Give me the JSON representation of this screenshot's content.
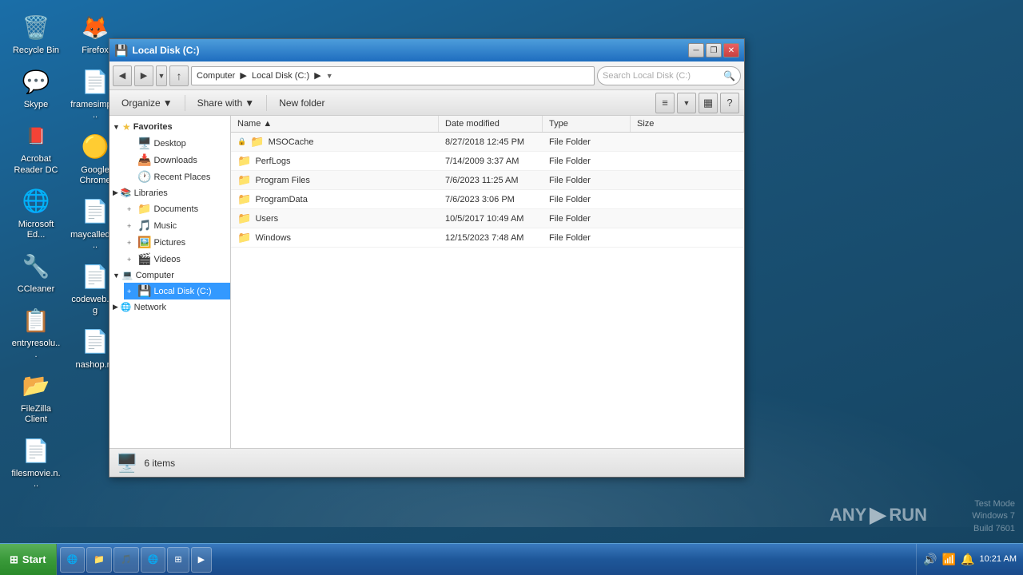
{
  "desktop": {
    "background_color": "#1a5276",
    "icons": [
      {
        "id": "recycle-bin",
        "label": "Recycle Bin",
        "icon": "🗑️"
      },
      {
        "id": "skype",
        "label": "Skype",
        "icon": "💬"
      },
      {
        "id": "acrobat",
        "label": "Acrobat Reader DC",
        "icon": "📄"
      },
      {
        "id": "microsoft-edge",
        "label": "Microsoft Ed...",
        "icon": "🌐"
      },
      {
        "id": "ccleaner",
        "label": "CCleaner",
        "icon": "🔧"
      },
      {
        "id": "entryresolution",
        "label": "entryresolu...",
        "icon": "📋"
      },
      {
        "id": "filezilla",
        "label": "FileZilla Client",
        "icon": "📂"
      },
      {
        "id": "filesmovie",
        "label": "filesmovie.n...",
        "icon": "📄"
      },
      {
        "id": "firefox",
        "label": "Firefox",
        "icon": "🦊"
      },
      {
        "id": "framesimply",
        "label": "framesimply...",
        "icon": "📄"
      },
      {
        "id": "chrome",
        "label": "Google Chrome",
        "icon": "🔵"
      },
      {
        "id": "maycalled",
        "label": "maycalled.p...",
        "icon": "📄"
      },
      {
        "id": "codeweb",
        "label": "codeweb.png",
        "icon": "📄"
      },
      {
        "id": "nashop",
        "label": "nashop.rtf",
        "icon": "📄"
      }
    ]
  },
  "taskbar": {
    "start_label": "Start",
    "time": "10:21 AM",
    "taskbar_items": [
      {
        "id": "ie",
        "label": "Internet Explorer",
        "icon": "🌐"
      },
      {
        "id": "folder",
        "label": "Folder",
        "icon": "📁"
      },
      {
        "id": "media",
        "label": "Media",
        "icon": "🎵"
      },
      {
        "id": "ie2",
        "label": "Internet Explorer",
        "icon": "🌐"
      },
      {
        "id": "windows",
        "label": "Windows",
        "icon": "⊞"
      },
      {
        "id": "arrow",
        "label": "Arrow",
        "icon": "▶"
      }
    ]
  },
  "watermark": {
    "line1": "Test Mode",
    "line2": "Windows 7",
    "line3": "Build 7601"
  },
  "anyrun": {
    "text": "ANY ▶ RUN"
  },
  "explorer": {
    "title": "Local Disk (C:)",
    "address": {
      "back_tooltip": "Back",
      "forward_tooltip": "Forward",
      "breadcrumb": "Computer  ▶  Local Disk (C:)  ▶",
      "search_placeholder": "Search Local Disk (C:)"
    },
    "toolbar": {
      "organize_label": "Organize",
      "share_with_label": "Share with",
      "new_folder_label": "New folder"
    },
    "nav_tree": {
      "favorites_label": "Favorites",
      "favorites_items": [
        {
          "id": "desktop",
          "label": "Desktop"
        },
        {
          "id": "downloads",
          "label": "Downloads"
        },
        {
          "id": "recent-places",
          "label": "Recent Places"
        }
      ],
      "libraries_label": "Libraries",
      "libraries_items": [
        {
          "id": "documents",
          "label": "Documents"
        },
        {
          "id": "music",
          "label": "Music"
        },
        {
          "id": "pictures",
          "label": "Pictures"
        },
        {
          "id": "videos",
          "label": "Videos"
        }
      ],
      "computer_label": "Computer",
      "computer_items": [
        {
          "id": "local-disk-c",
          "label": "Local Disk (C:)",
          "selected": true
        }
      ],
      "network_label": "Network"
    },
    "file_list": {
      "columns": [
        {
          "id": "name",
          "label": "Name"
        },
        {
          "id": "date_modified",
          "label": "Date modified"
        },
        {
          "id": "type",
          "label": "Type"
        },
        {
          "id": "size",
          "label": "Size"
        }
      ],
      "files": [
        {
          "name": "MSOCache",
          "date": "8/27/2018 12:45 PM",
          "type": "File Folder",
          "size": "",
          "locked": true
        },
        {
          "name": "PerfLogs",
          "date": "7/14/2009 3:37 AM",
          "type": "File Folder",
          "size": "",
          "locked": false
        },
        {
          "name": "Program Files",
          "date": "7/6/2023 11:25 AM",
          "type": "File Folder",
          "size": "",
          "locked": false
        },
        {
          "name": "ProgramData",
          "date": "7/6/2023 3:06 PM",
          "type": "File Folder",
          "size": "",
          "locked": false
        },
        {
          "name": "Users",
          "date": "10/5/2017 10:49 AM",
          "type": "File Folder",
          "size": "",
          "locked": false
        },
        {
          "name": "Windows",
          "date": "12/15/2023 7:48 AM",
          "type": "File Folder",
          "size": "",
          "locked": false
        }
      ]
    },
    "status": {
      "item_count": "6 items"
    }
  }
}
